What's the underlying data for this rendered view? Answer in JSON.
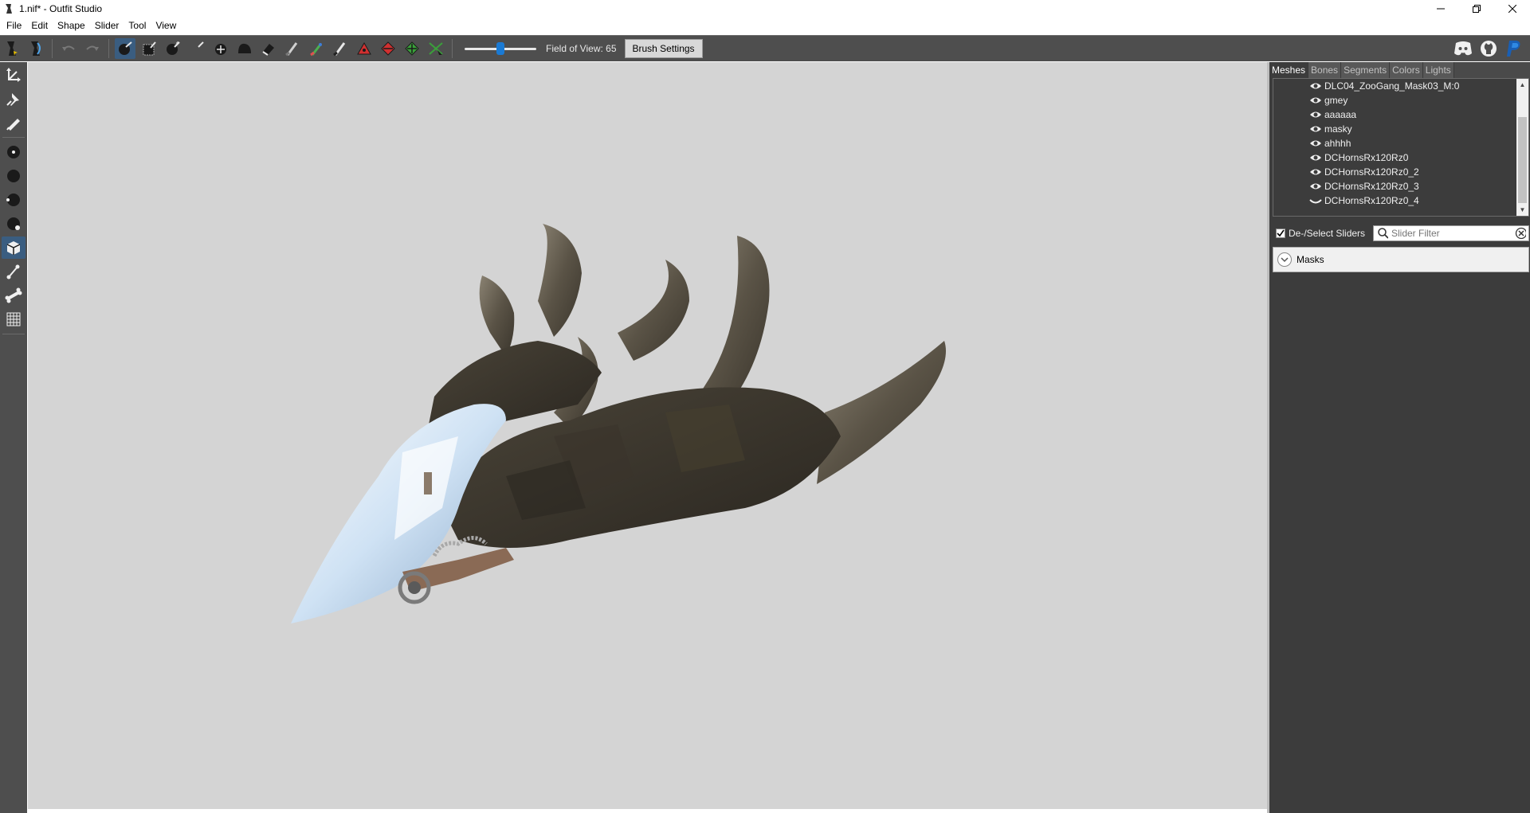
{
  "window": {
    "title": "1.nif* - Outfit Studio",
    "minimize": "minimize",
    "restore": "restore",
    "close": "close"
  },
  "menu": [
    "File",
    "Edit",
    "Shape",
    "Slider",
    "Tool",
    "View"
  ],
  "toolbar": {
    "fov_label": "Field of View: 65",
    "fov_value": 65,
    "brush_settings_label": "Brush Settings",
    "icons": [
      "select-shape-icon",
      "select-slider-icon",
      "undo-icon",
      "redo-icon",
      "select-brush-icon",
      "mask-brush-icon",
      "inflate-brush-icon",
      "deflate-brush-icon",
      "move-brush-icon",
      "smooth-brush-icon",
      "undiff-brush-icon",
      "weight-brush-icon",
      "color-brush-icon",
      "alpha-brush-icon",
      "collapse-vertex-icon",
      "flip-edge-icon",
      "split-edge-icon",
      "delete-vertex-icon"
    ],
    "right_icons": [
      "discord-icon",
      "github-icon",
      "paypal-icon"
    ]
  },
  "left_tools": [
    "transform-tool-icon",
    "pivot-tool-icon",
    "vertex-edit-icon",
    "brush-size-1-icon",
    "brush-size-2-icon",
    "brush-size-3-icon",
    "brush-size-4-icon",
    "cube-view-icon",
    "bone-chain-icon",
    "bone-icon",
    "grid-icon"
  ],
  "right_panel": {
    "tabs": [
      "Meshes",
      "Bones",
      "Segments",
      "Colors",
      "Lights"
    ],
    "active_tab": "Meshes",
    "meshes": [
      {
        "name": "DLC04_ZooGang_Mask03_M:0",
        "visible": true
      },
      {
        "name": "gmey",
        "visible": true
      },
      {
        "name": "aaaaaa",
        "visible": true
      },
      {
        "name": "masky",
        "visible": true
      },
      {
        "name": "ahhhh",
        "visible": true
      },
      {
        "name": "DCHornsRx120Rz0",
        "visible": true
      },
      {
        "name": "DCHornsRx120Rz0_2",
        "visible": true
      },
      {
        "name": "DCHornsRx120Rz0_3",
        "visible": true
      },
      {
        "name": "DCHornsRx120Rz0_4",
        "visible": false
      }
    ],
    "deselect_sliders_label": "De-/Select Sliders",
    "deselect_checked": true,
    "slider_filter_placeholder": "Slider Filter",
    "slider_groups": [
      {
        "label": "Masks"
      }
    ]
  },
  "colors": {
    "toolbar_bg": "#4e4e4e",
    "viewport_bg": "#d4d4d4",
    "panel_bg": "#3c3c3c",
    "accent": "#1a7ad4"
  }
}
